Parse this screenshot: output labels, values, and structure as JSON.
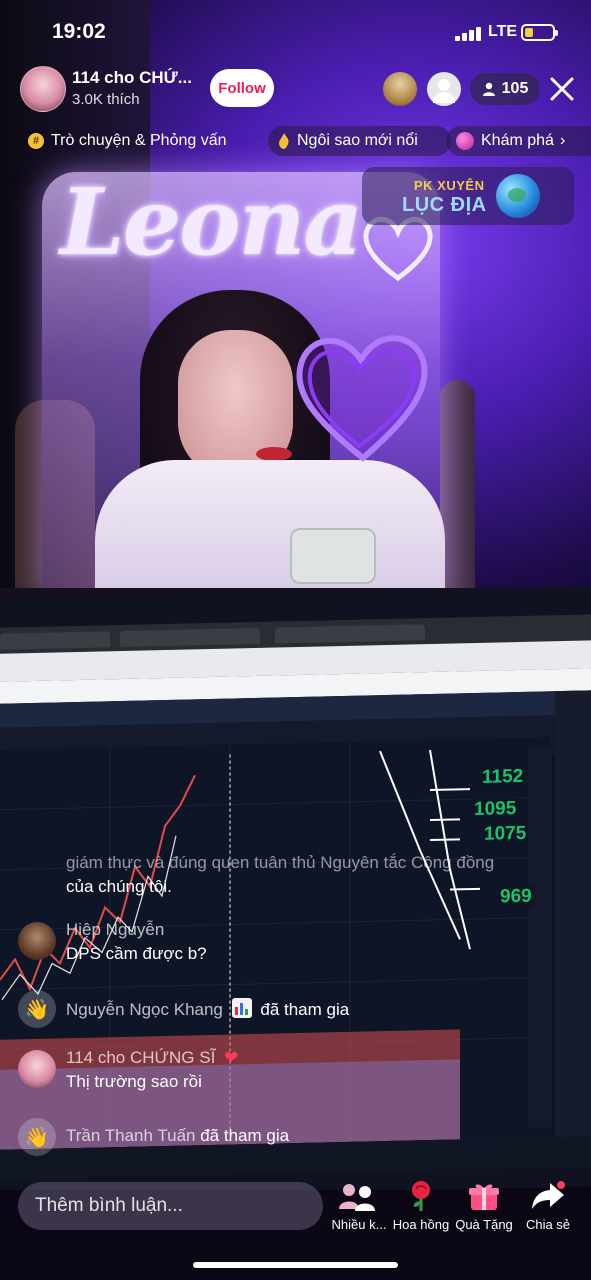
{
  "status_bar": {
    "time": "19:02",
    "network": "LTE"
  },
  "host": {
    "name": "114 cho CHỨ...",
    "likes": "3.0K thích",
    "follow_label": "Follow"
  },
  "viewers": {
    "count": "105",
    "icon": "person-icon"
  },
  "categories": [
    {
      "label": "Trò chuyện & Phỏng vấn",
      "icon": "hash-icon"
    },
    {
      "label": "Ngôi sao mới nổi",
      "icon": "flame-icon"
    },
    {
      "label": "Khám phá",
      "icon": "planet-icon"
    }
  ],
  "pk_badge": {
    "line1": "PK XUYÊN",
    "line2": "LỤC ĐỊA"
  },
  "stream_overlay": {
    "sign_text": "Leona"
  },
  "chart_prices": [
    "1152",
    "1095",
    "1075",
    "969"
  ],
  "chat": {
    "partial_line": "giám thực và đúng quen tuân thủ Nguyên tắc Cộng đồng",
    "partial_end": "của chúng tôi.",
    "messages": [
      {
        "type": "comment",
        "user": "Hiệp Nguyễn",
        "text": "DPS cầm được b?"
      },
      {
        "type": "join",
        "user": "Nguyễn Ngọc Khang",
        "suffix": "đã tham gia"
      },
      {
        "type": "comment",
        "user": "114 cho CHỨNG SĨ",
        "text": "Thị trường sao rồi"
      },
      {
        "type": "join",
        "user": "Trần Thanh Tuấn",
        "suffix": "đã tham gia"
      }
    ]
  },
  "bottom_bar": {
    "comment_placeholder": "Thêm bình luận...",
    "actions": [
      {
        "label": "Nhiều k...",
        "icon": "multi-guest-icon"
      },
      {
        "label": "Hoa hồng",
        "icon": "rose-icon"
      },
      {
        "label": "Quà Tặng",
        "icon": "gift-icon"
      },
      {
        "label": "Chia sẻ",
        "icon": "share-icon"
      }
    ]
  },
  "colors": {
    "follow_text": "#ee1d52",
    "accent_purple": "#7a3df0",
    "chart_green": "#19c36a"
  }
}
